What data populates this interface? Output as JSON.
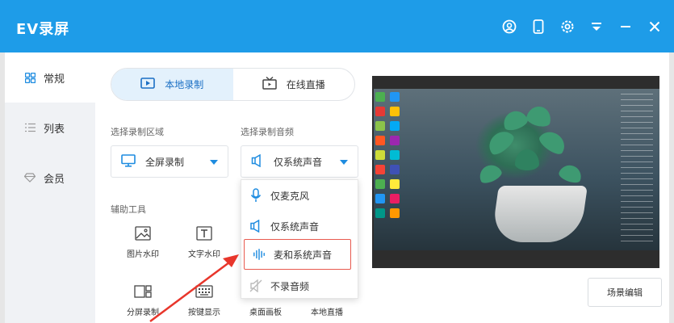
{
  "app": {
    "title": "EV录屏"
  },
  "titlebar": {
    "icons": [
      "user-icon",
      "phone-icon",
      "settings-icon",
      "menu-icon",
      "minimize-icon",
      "close-icon"
    ]
  },
  "sidebar": {
    "items": [
      {
        "label": "常规",
        "icon": "grid-icon",
        "active": true
      },
      {
        "label": "列表",
        "icon": "list-icon",
        "active": false
      },
      {
        "label": "会员",
        "icon": "diamond-icon",
        "active": false
      }
    ]
  },
  "mode_tabs": [
    {
      "label": "本地录制",
      "icon": "record-icon",
      "active": true
    },
    {
      "label": "在线直播",
      "icon": "tv-icon",
      "active": false
    }
  ],
  "record_area": {
    "label": "选择录制区域",
    "value": "全屏录制"
  },
  "record_audio": {
    "label": "选择录制音频",
    "value": "仅系统声音"
  },
  "tools": {
    "label": "辅助工具",
    "items": [
      {
        "label": "图片水印",
        "icon": "image-icon"
      },
      {
        "label": "文字水印",
        "icon": "text-icon"
      },
      {
        "label": "分屏录制",
        "icon": "split-screen-icon"
      },
      {
        "label": "按键显示",
        "icon": "keyboard-icon"
      },
      {
        "label": "桌面画板",
        "icon": "desktop-board-icon"
      },
      {
        "label": "本地直播",
        "icon": "local-live-icon"
      }
    ]
  },
  "audio_options": [
    {
      "label": "仅麦克风",
      "icon": "microphone-icon"
    },
    {
      "label": "仅系统声音",
      "icon": "speaker-icon"
    },
    {
      "label": "麦和系统声音",
      "icon": "waveform-icon",
      "highlighted": true
    },
    {
      "label": "不录音频",
      "icon": "mute-icon"
    }
  ],
  "scene_edit_label": "场景编辑",
  "colors": {
    "accent": "#1e9ce8",
    "highlight": "#e85a4f",
    "arrow": "#e8362b"
  }
}
